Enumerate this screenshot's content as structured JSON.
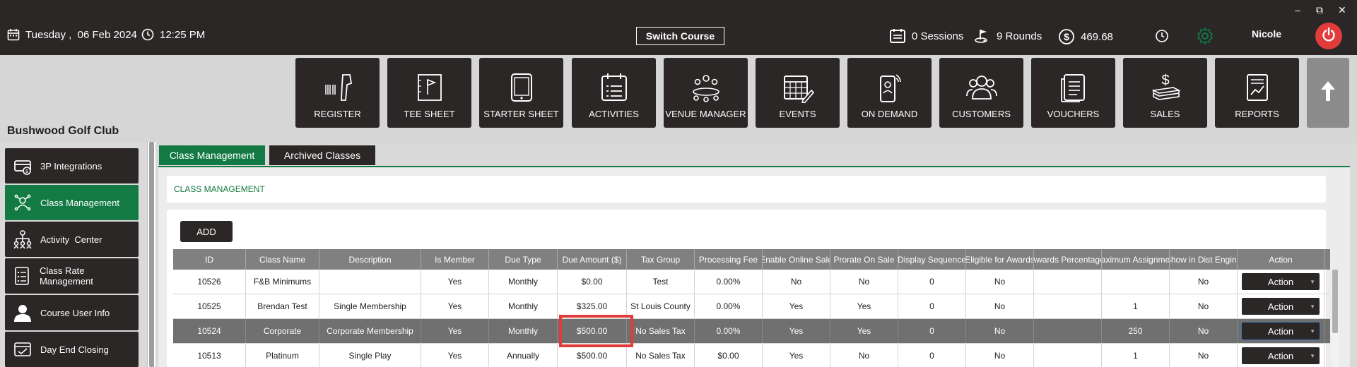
{
  "header": {
    "date": "Tuesday ,  06 Feb 2024",
    "time": "12:25 PM",
    "switch_course": "Switch Course",
    "sessions": "0 Sessions",
    "rounds": "9 Rounds",
    "balance": "469.68",
    "user": "Nicole",
    "window_controls": [
      "–",
      "⧉",
      "✕"
    ]
  },
  "modules": [
    {
      "label": "REGISTER",
      "icon": "barcode-scanner-icon"
    },
    {
      "label": "TEE SHEET",
      "icon": "flag-icon"
    },
    {
      "label": "STARTER SHEET",
      "icon": "tablet-icon"
    },
    {
      "label": "ACTIVITIES",
      "icon": "calendar-list-icon"
    },
    {
      "label": "VENUE MANAGER",
      "icon": "meeting-icon"
    },
    {
      "label": "EVENTS",
      "icon": "calendar-edit-icon"
    },
    {
      "label": "ON DEMAND",
      "icon": "phone-signal-icon"
    },
    {
      "label": "CUSTOMERS",
      "icon": "users-icon"
    },
    {
      "label": "VOUCHERS",
      "icon": "voucher-icon"
    },
    {
      "label": "SALES",
      "icon": "dollar-stack-icon"
    },
    {
      "label": "REPORTS",
      "icon": "report-icon"
    }
  ],
  "club_name": "Bushwood Golf Club",
  "sidebar": {
    "items": [
      {
        "label": "3P Integrations",
        "icon": "integration-icon"
      },
      {
        "label": "Class Management",
        "icon": "class-icon"
      },
      {
        "label": "Activity  Center",
        "icon": "org-chart-icon"
      },
      {
        "label": "Class Rate Management",
        "icon": "checklist-icon"
      },
      {
        "label": "Course User Info",
        "icon": "user-icon"
      },
      {
        "label": "Day End Closing",
        "icon": "day-end-icon"
      }
    ]
  },
  "tabs": [
    {
      "label": "Class Management"
    },
    {
      "label": "Archived Classes"
    }
  ],
  "section_title": "CLASS MANAGEMENT",
  "add_label": "ADD",
  "table": {
    "headers": [
      "ID",
      "Class Name",
      "Description",
      "Is Member",
      "Due Type",
      "Due Amount ($)",
      "Tax Group",
      "Processing Fee",
      "Enable Online Sale",
      "Prorate On Sale",
      "Display Sequence",
      "Eligible for Awards",
      "Awards Percentage",
      "Maximum Assignment",
      "Show in Dist Engine",
      "Action"
    ],
    "rows": [
      [
        "10526",
        "F&B Minimums",
        "",
        "Yes",
        "Monthly",
        "$0.00",
        "Test",
        "0.00%",
        "No",
        "No",
        "0",
        "No",
        "",
        "",
        "No",
        "Action"
      ],
      [
        "10525",
        "Brendan Test",
        "Single Membership",
        "Yes",
        "Monthly",
        "$325.00",
        "St Louis County",
        "0.00%",
        "Yes",
        "Yes",
        "0",
        "No",
        "",
        "1",
        "No",
        "Action"
      ],
      [
        "10524",
        "Corporate",
        "Corporate Membership",
        "Yes",
        "Monthly",
        "$500.00",
        "No Sales Tax",
        "0.00%",
        "Yes",
        "Yes",
        "0",
        "No",
        "",
        "250",
        "No",
        "Action"
      ],
      [
        "10513",
        "Platinum",
        "Single Play",
        "Yes",
        "Annually",
        "$500.00",
        "No Sales Tax",
        "$0.00",
        "Yes",
        "No",
        "0",
        "No",
        "",
        "1",
        "No",
        "Action"
      ]
    ]
  },
  "colors": {
    "dark": "#2b2726",
    "accent_green": "#127a42",
    "highlight_red": "#e23b3b",
    "header_gray": "#808080"
  }
}
